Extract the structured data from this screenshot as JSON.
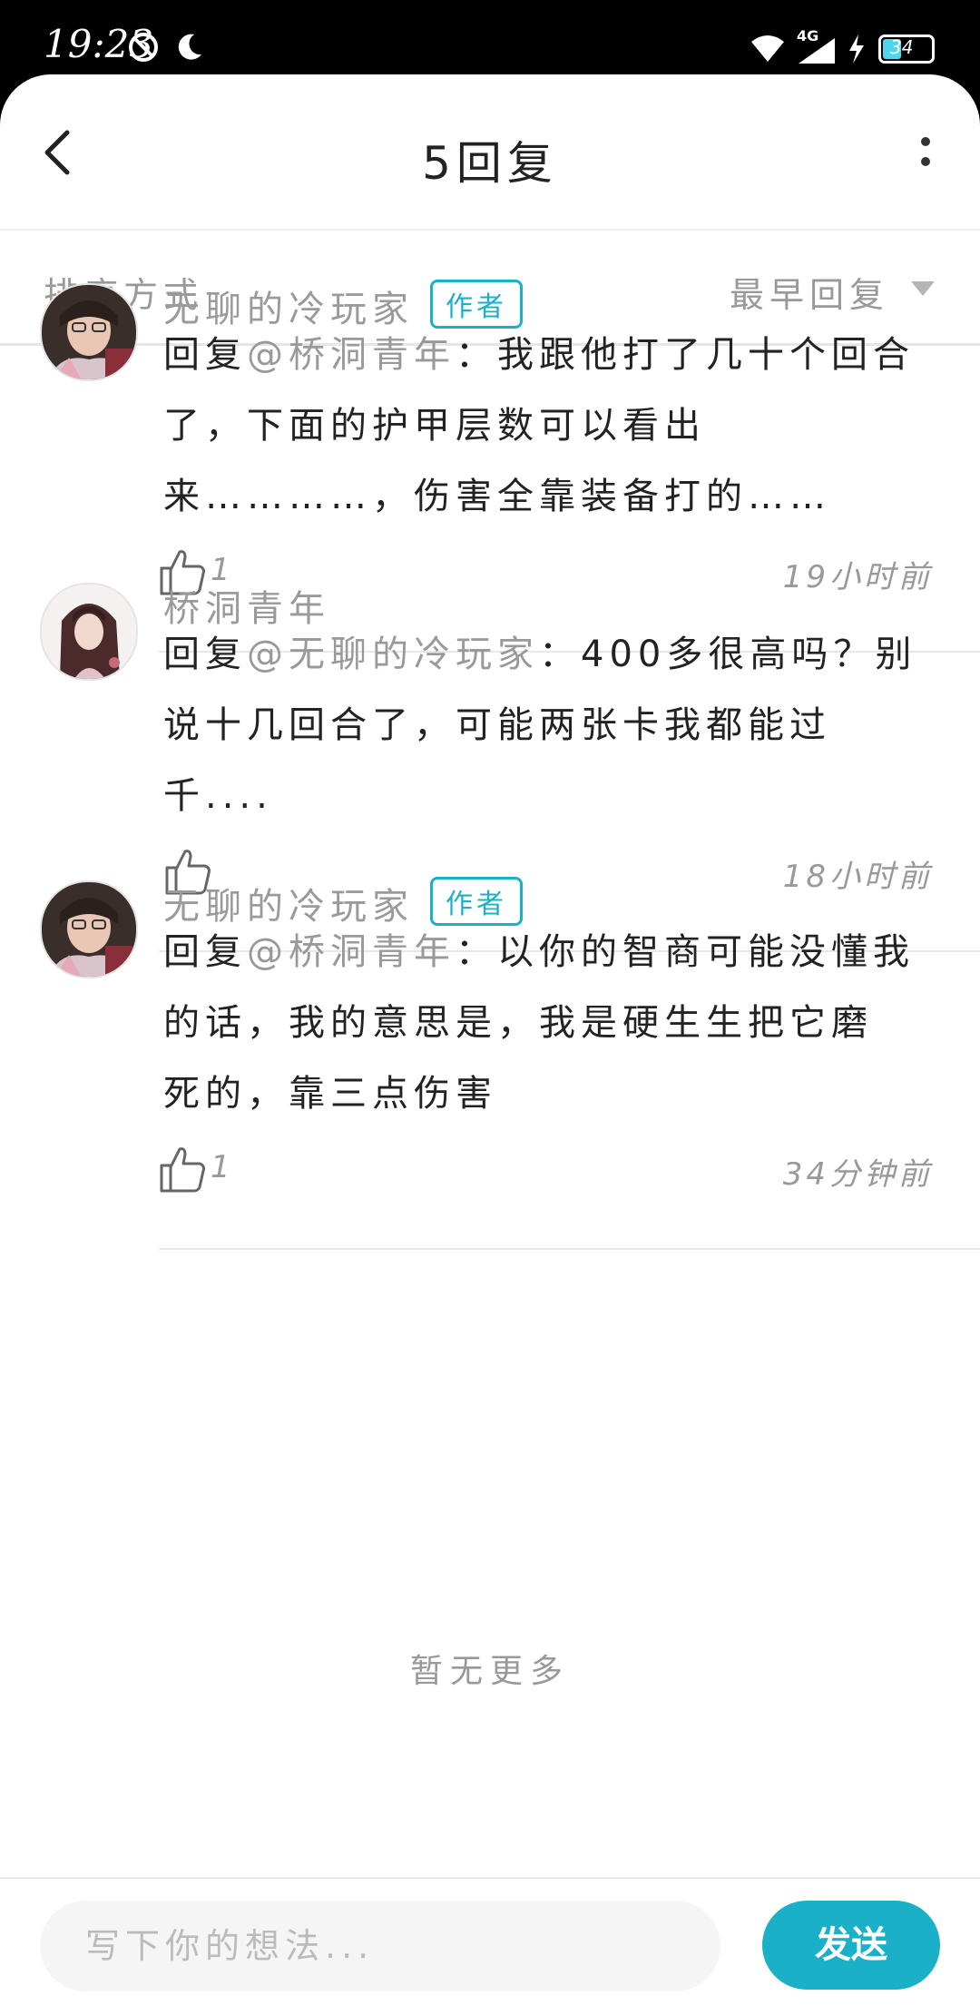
{
  "status_bar": {
    "time": "19:23",
    "network": "4G",
    "battery": "34"
  },
  "header": {
    "title": "5回复"
  },
  "sort": {
    "label": "排序方式",
    "value": "最早回复"
  },
  "replies": [
    {
      "author": "无聊的冷玩家",
      "badge": "作者",
      "prefix": "回复",
      "mention": "@桥洞青年",
      "line1_rest": "：我跟他打了几十个回合",
      "line2": "了，下面的护甲层数可以看出",
      "line3": "来…………，伤害全靠装备打的……",
      "likes": "1",
      "time": "19小时前"
    },
    {
      "author": "桥洞青年",
      "badge": "",
      "prefix": "回复",
      "mention": "@无聊的冷玩家",
      "line1_rest": "：400多很高吗？别",
      "line2": "说十几回合了，可能两张卡我都能过",
      "line3": "千....",
      "likes": "",
      "time": "18小时前"
    },
    {
      "author": "无聊的冷玩家",
      "badge": "作者",
      "prefix": "回复",
      "mention": "@桥洞青年",
      "line1_rest": "：以你的智商可能没懂我",
      "line2": "的话，我的意思是，我是硬生生把它磨",
      "line3": "死的，靠三点伤害",
      "likes": "1",
      "time": "34分钟前"
    }
  ],
  "no_more": "暂无更多",
  "composer": {
    "placeholder": "写下你的想法...",
    "send_label": "发送"
  },
  "colors": {
    "accent": "#1ab0c7"
  }
}
